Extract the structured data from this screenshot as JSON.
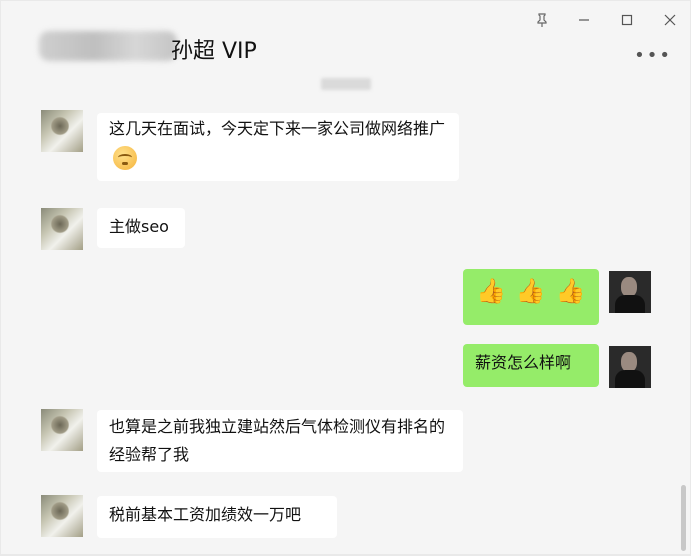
{
  "window": {
    "title": "孙超 VIP",
    "controls": [
      "pin-icon",
      "minimize-icon",
      "maximize-icon",
      "close-icon"
    ]
  },
  "messages": [
    {
      "side": "left",
      "text": "这几天在面试，今天定下来一家公司做网络推广",
      "emoji": "nerd-face-icon"
    },
    {
      "side": "left",
      "text": "主做seo"
    },
    {
      "side": "right",
      "text": "👍👍👍"
    },
    {
      "side": "right",
      "text": "薪资怎么样啊"
    },
    {
      "side": "left",
      "text": "也算是之前我独立建站然后气体检测仪有排名的经验帮了我"
    },
    {
      "side": "left",
      "text": "税前基本工资加绩效一万吧"
    }
  ]
}
